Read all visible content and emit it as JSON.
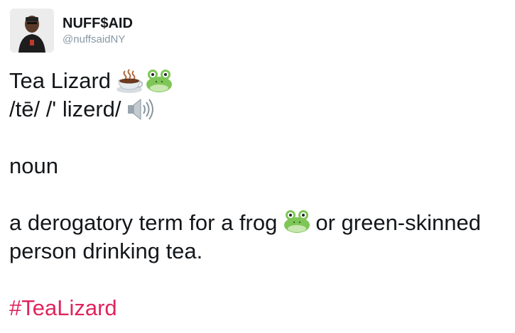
{
  "author": {
    "display_name": "NUFF$AID",
    "handle": "@nuffsaidNY",
    "avatar_icon": "user-photo-avatar"
  },
  "tweet": {
    "title": "Tea Lizard",
    "title_emojis": [
      "tea-cup-icon",
      "frog-face-icon"
    ],
    "pronunciation": "/tē/ /' lizerd/",
    "pronunciation_icon": "speaker-icon",
    "part_of_speech": "noun",
    "definition_start": "a derogatory term for a frog",
    "definition_emoji": "frog-face-icon",
    "definition_end": "or green-skinned person drinking tea.",
    "hashtag": "#TeaLizard"
  },
  "colors": {
    "text": "#14171a",
    "handle": "#8899a6",
    "hashtag": "#e0245e",
    "frog_green": "#7ec657"
  }
}
